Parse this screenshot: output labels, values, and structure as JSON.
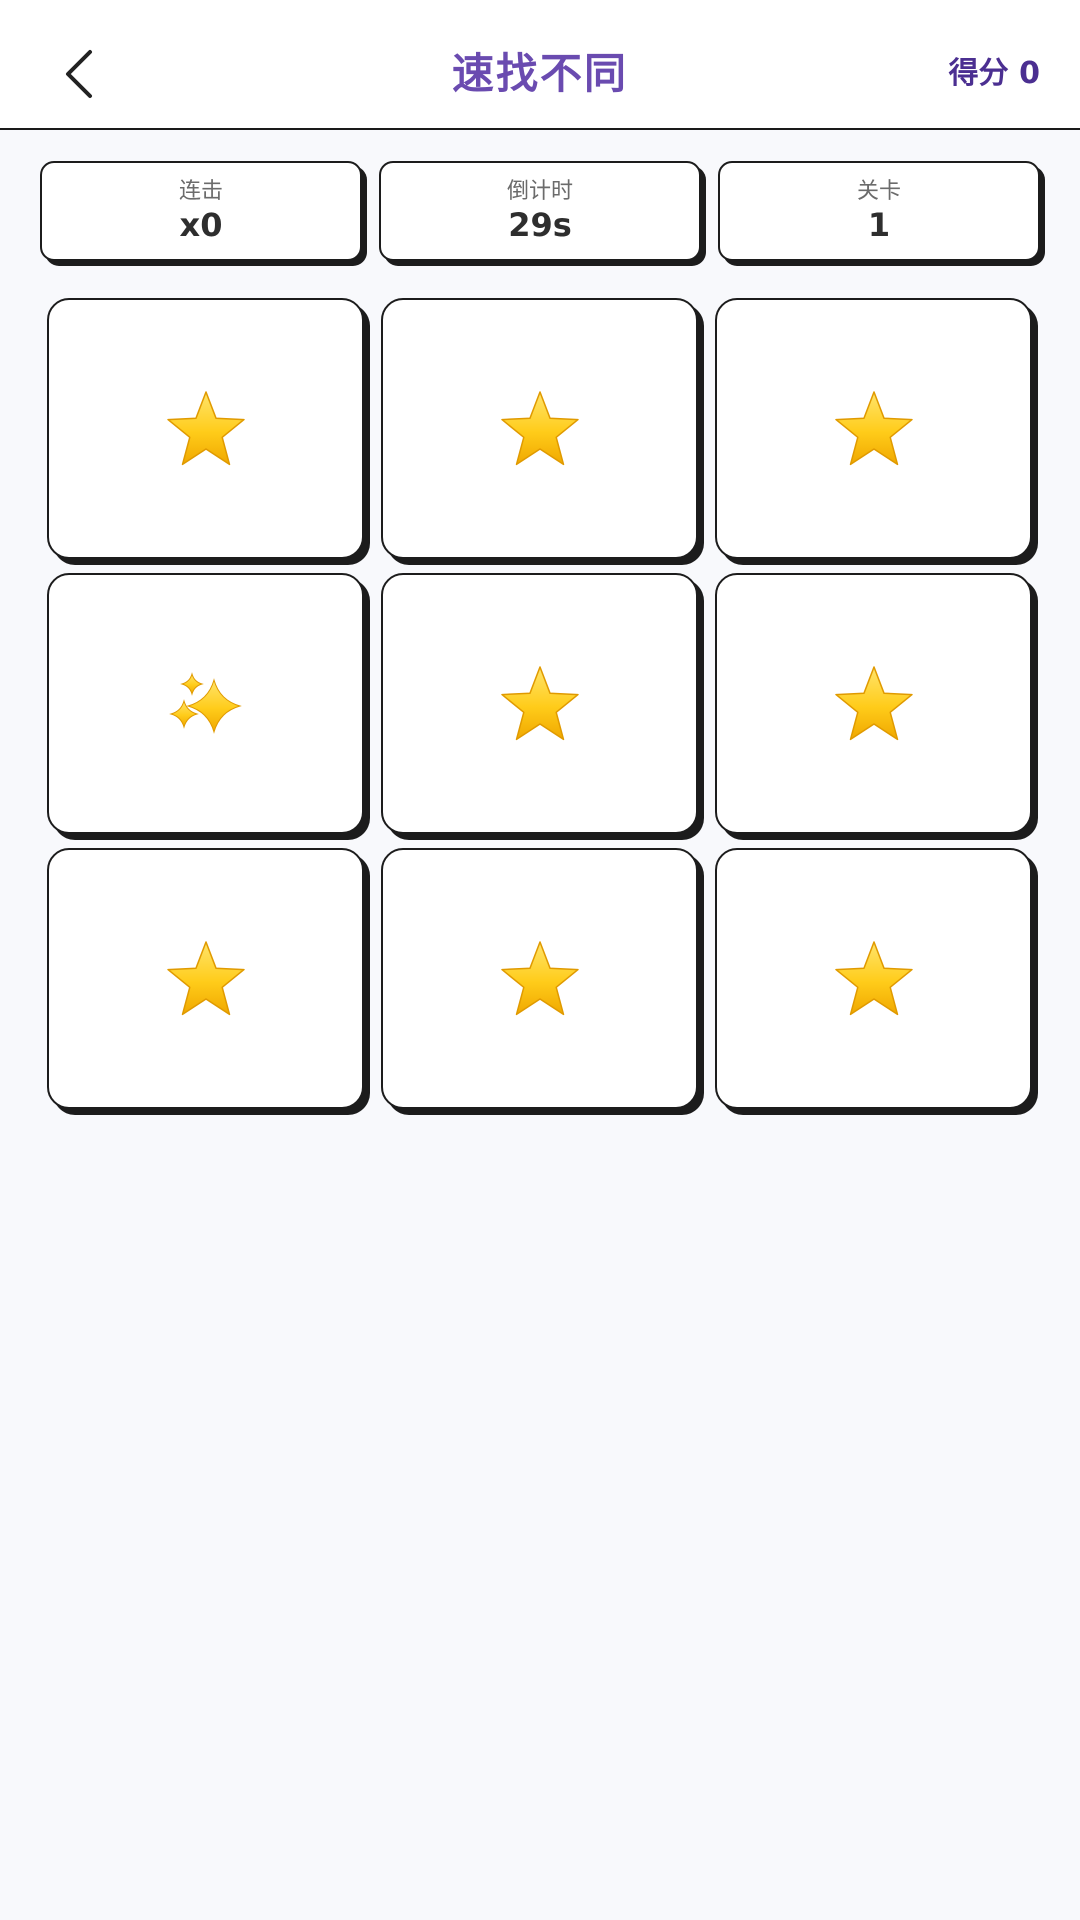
{
  "header": {
    "title": "速找不同",
    "score_text": "得分 0"
  },
  "stats": [
    {
      "label": "连击",
      "value": "x0"
    },
    {
      "label": "倒计时",
      "value": "29s"
    },
    {
      "label": "关卡",
      "value": "1"
    }
  ],
  "grid": {
    "rows": 3,
    "cols": 3,
    "cells": [
      {
        "icon": "star-icon"
      },
      {
        "icon": "star-icon"
      },
      {
        "icon": "star-icon"
      },
      {
        "icon": "sparkles-icon"
      },
      {
        "icon": "star-icon"
      },
      {
        "icon": "star-icon"
      },
      {
        "icon": "star-icon"
      },
      {
        "icon": "star-icon"
      },
      {
        "icon": "star-icon"
      }
    ]
  },
  "colors": {
    "title": "#6a4bb0",
    "score": "#4b2f91",
    "background": "#f8f9fc",
    "star": "#ffcc1a"
  }
}
